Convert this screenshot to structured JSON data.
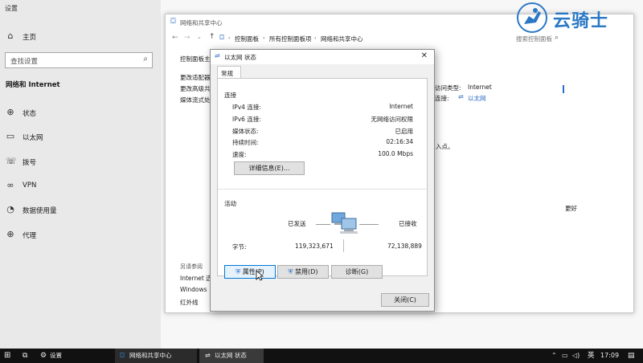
{
  "settings": {
    "title": "设置",
    "home": "主页",
    "search_placeholder": "查找设置",
    "section": "网络和 Internet",
    "nav": [
      "状态",
      "以太网",
      "拨号",
      "VPN",
      "数据使用量",
      "代理"
    ]
  },
  "control_panel": {
    "title": "网络和共享中心",
    "breadcrumb": [
      "控制面板",
      "所有控制面板项",
      "网络和共享中心"
    ],
    "search_placeholder": "搜索控制面板",
    "sidebar_top": "控制面板主",
    "sidebar_links": [
      "更改适配器",
      "更改高级共",
      "媒体流式处"
    ],
    "access_type_label": "访问类型:",
    "access_type_value": "Internet",
    "connection_label": "连接:",
    "connection_value": "以太网",
    "partial_text_1": "入点。",
    "partial_text_2": "更好",
    "see_also_label": "另请参阅",
    "see_also_items": [
      "Internet 选",
      "Windows",
      "红外线"
    ]
  },
  "dialog": {
    "title": "以太网 状态",
    "tab": "常规",
    "connection_section": "连接",
    "rows": [
      {
        "label": "IPv4 连接:",
        "value": "Internet"
      },
      {
        "label": "IPv6 连接:",
        "value": "无网络访问权限"
      },
      {
        "label": "媒体状态:",
        "value": "已启用"
      },
      {
        "label": "持续时间:",
        "value": "02:16:34"
      },
      {
        "label": "速度:",
        "value": "100.0 Mbps"
      }
    ],
    "details_button": "详细信息(E)...",
    "activity_section": "活动",
    "sent_label": "已发送",
    "received_label": "已接收",
    "bytes_label": "字节:",
    "bytes_sent": "119,323,671",
    "bytes_received": "72,138,889",
    "properties_button": "属性(P)",
    "disable_button": "禁用(D)",
    "diagnose_button": "诊断(G)",
    "close_button": "关闭(C)"
  },
  "taskbar": {
    "apps": [
      "设置",
      "网络和共享中心",
      "以太网 状态"
    ],
    "ime": "英",
    "time": "17:09"
  },
  "watermark": {
    "text": "云骑士"
  }
}
